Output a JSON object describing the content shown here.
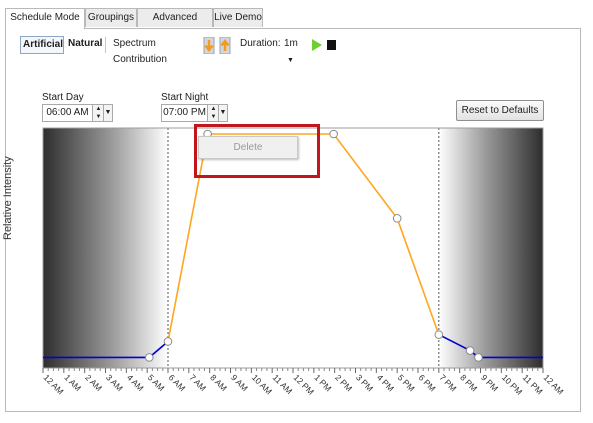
{
  "tabs": [
    "Schedule Mode",
    "Groupings",
    "Advanced Settings",
    "Live Demo"
  ],
  "toolbar": {
    "artificial": "Artificial",
    "natural": "Natural",
    "spectrum": "Spectrum Contribution",
    "duration_label": "Duration:",
    "duration_value": "1m",
    "icons": [
      "arrow-down-icon",
      "arrow-up-icon",
      "play-icon",
      "stop-icon"
    ]
  },
  "start_day": {
    "label": "Start Day",
    "value": "06:00 AM"
  },
  "start_night": {
    "label": "Start Night",
    "value": "07:00 PM"
  },
  "reset_label": "Reset to Defaults",
  "context_menu": {
    "items": [
      "Delete"
    ]
  },
  "chart_data": {
    "type": "line",
    "ylabel": "Relative Intensity",
    "xlabel": "",
    "x_tick_labels": [
      "12 AM",
      "1 AM",
      "2 AM",
      "3 AM",
      "4 AM",
      "5 AM",
      "6 AM",
      "7 AM",
      "8 AM",
      "9 AM",
      "10 AM",
      "11 AM",
      "12 PM",
      "1 PM",
      "2 PM",
      "3 PM",
      "4 PM",
      "5 PM",
      "6 PM",
      "7 PM",
      "8 PM",
      "9 PM",
      "10 PM",
      "11 PM",
      "12 AM"
    ],
    "xlim": [
      0,
      24
    ],
    "ylim": [
      0,
      1
    ],
    "day_start_hour": 6,
    "night_start_hour": 19,
    "series": [
      {
        "color": "#0000d8",
        "points": [
          [
            0,
            0.02
          ],
          [
            5.1,
            0.02
          ],
          [
            6,
            0.09
          ]
        ]
      },
      {
        "color": "#ffa51f",
        "points": [
          [
            6,
            0.09
          ],
          [
            7.9,
            1.0
          ],
          [
            13.95,
            1.0
          ],
          [
            17,
            0.63
          ],
          [
            19,
            0.12
          ]
        ]
      },
      {
        "color": "#0000d8",
        "points": [
          [
            19,
            0.12
          ],
          [
            20.5,
            0.05
          ],
          [
            20.9,
            0.02
          ],
          [
            24,
            0.02
          ]
        ]
      }
    ],
    "highlight_color": "#c0161c"
  }
}
